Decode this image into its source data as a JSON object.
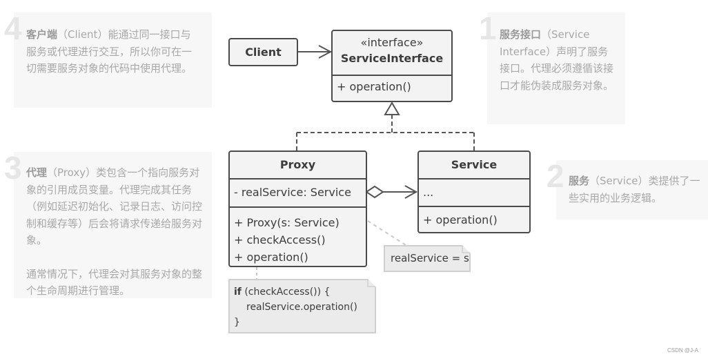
{
  "callouts": [
    {
      "num": "4",
      "bold": "客户端",
      "text": "（Client）能通过同一接口与服务或代理进行交互，所以你可在一切需要服务对象的代码中使用代理。"
    },
    {
      "num": "1",
      "bold": "服务接口",
      "text": "（Service Interface）声明了服务接口。代理必须遵循该接口才能伪装成服务对象。"
    },
    {
      "num": "3",
      "bold": "代理",
      "text": "（Proxy）类包含一个指向服务对象的引用成员变量。代理完成其任务（例如延迟初始化、记录日志、访问控制和缓存等）后会将请求传递给服务对象。",
      "text2": "通常情况下，代理会对其服务对象的整个生命周期进行管理。"
    },
    {
      "num": "2",
      "bold": "服务",
      "text": "（Service）类提供了一些实用的业务逻辑。"
    }
  ],
  "diagram": {
    "client": {
      "name": "Client"
    },
    "interface": {
      "stereotype": "«interface»",
      "name": "ServiceInterface",
      "methods": [
        "+ operation()"
      ]
    },
    "proxy": {
      "name": "Proxy",
      "fields": [
        "- realService: Service"
      ],
      "methods": [
        "+ Proxy(s: Service)",
        "+ checkAccess()",
        "+ operation()"
      ]
    },
    "service": {
      "name": "Service",
      "fields": [
        "..."
      ],
      "methods": [
        "+ operation()"
      ]
    },
    "note_constructor": "realService = s",
    "note_operation": {
      "kw": "if",
      "line1": " (checkAccess()) {",
      "line2": "realService.operation()",
      "line3": "}"
    }
  },
  "watermark": "CSDN @J-A"
}
